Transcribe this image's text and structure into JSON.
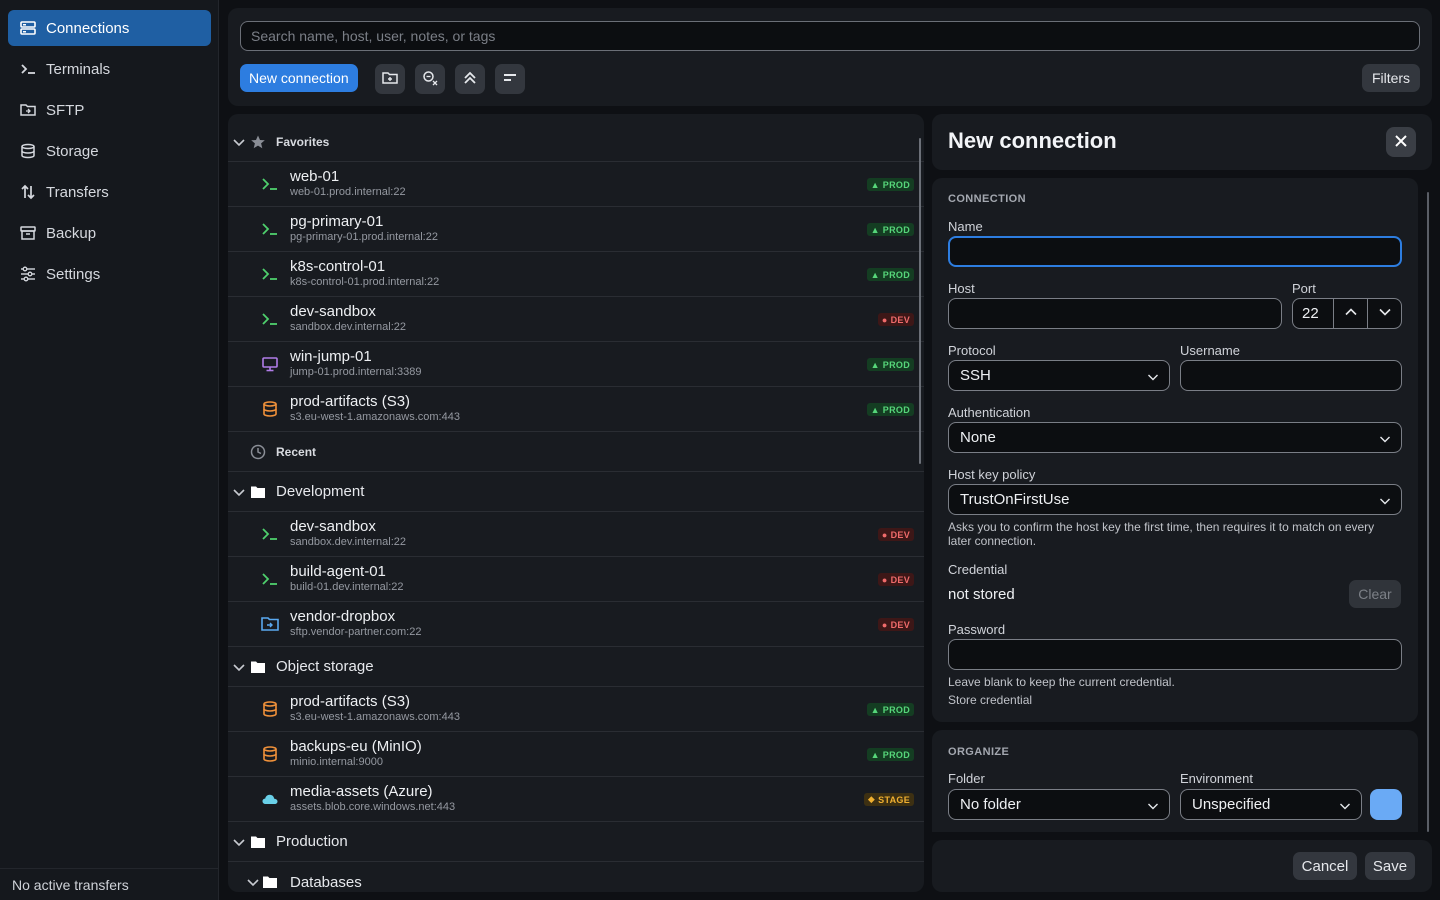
{
  "sidebar": {
    "items": [
      {
        "label": "Connections",
        "icon": "server-stack-icon",
        "active": true
      },
      {
        "label": "Terminals",
        "icon": "terminal-icon"
      },
      {
        "label": "SFTP",
        "icon": "sftp-folder-icon"
      },
      {
        "label": "Storage",
        "icon": "database-icon"
      },
      {
        "label": "Transfers",
        "icon": "transfer-arrows-icon"
      },
      {
        "label": "Backup",
        "icon": "archive-box-icon"
      },
      {
        "label": "Settings",
        "icon": "sliders-icon"
      }
    ],
    "footer": "No active transfers"
  },
  "toolbar": {
    "search_placeholder": "Search name, host, user, notes, or tags",
    "new_connection": "New connection",
    "filters": "Filters"
  },
  "favorites": {
    "title": "Favorites",
    "rows": [
      {
        "name": "web-01",
        "host": "web-01.prod.internal:22",
        "icon": "terminal-icon",
        "env": "PROD"
      },
      {
        "name": "pg-primary-01",
        "host": "pg-primary-01.prod.internal:22",
        "icon": "terminal-icon",
        "env": "PROD"
      },
      {
        "name": "k8s-control-01",
        "host": "k8s-control-01.prod.internal:22",
        "icon": "terminal-icon",
        "env": "PROD"
      },
      {
        "name": "dev-sandbox",
        "host": "sandbox.dev.internal:22",
        "icon": "terminal-icon",
        "env": "DEV"
      },
      {
        "name": "win-jump-01",
        "host": "jump-01.prod.internal:3389",
        "icon": "monitor-icon",
        "env": "PROD"
      },
      {
        "name": "prod-artifacts (S3)",
        "host": "s3.eu-west-1.amazonaws.com:443",
        "icon": "bucket-icon",
        "env": "PROD"
      }
    ]
  },
  "recent": {
    "title": "Recent"
  },
  "development": {
    "title": "Development",
    "rows": [
      {
        "name": "dev-sandbox",
        "host": "sandbox.dev.internal:22",
        "icon": "terminal-icon",
        "env": "DEV"
      },
      {
        "name": "build-agent-01",
        "host": "build-01.dev.internal:22",
        "icon": "terminal-icon",
        "env": "DEV"
      },
      {
        "name": "vendor-dropbox",
        "host": "sftp.vendor-partner.com:22",
        "icon": "sftp-folder-icon",
        "env": "DEV"
      }
    ]
  },
  "object_storage": {
    "title": "Object storage",
    "rows": [
      {
        "name": "prod-artifacts (S3)",
        "host": "s3.eu-west-1.amazonaws.com:443",
        "icon": "bucket-icon",
        "env": "PROD"
      },
      {
        "name": "backups-eu (MinIO)",
        "host": "minio.internal:9000",
        "icon": "bucket-icon",
        "env": "PROD"
      },
      {
        "name": "media-assets (Azure)",
        "host": "assets.blob.core.windows.net:443",
        "icon": "cloud-icon",
        "env": "STAGE"
      }
    ]
  },
  "production": {
    "title": "Production"
  },
  "databases": {
    "title": "Databases"
  },
  "panel": {
    "title": "New connection",
    "connection_section": "CONNECTION",
    "name_label": "Name",
    "name_value": "",
    "host_label": "Host",
    "host_value": "",
    "port_label": "Port",
    "port_value": "22",
    "protocol_label": "Protocol",
    "protocol_value": "SSH",
    "username_label": "Username",
    "username_value": "",
    "auth_label": "Authentication",
    "auth_value": "None",
    "hostkey_label": "Host key policy",
    "hostkey_value": "TrustOnFirstUse",
    "hostkey_help": "Asks you to confirm the host key the first time, then requires it to match on every later connection.",
    "credential_label": "Credential",
    "credential_value": "not stored",
    "clear": "Clear",
    "password_label": "Password",
    "password_help": "Leave blank to keep the current credential.",
    "store_credential": "Store credential",
    "organize_section": "ORGANIZE",
    "folder_label": "Folder",
    "folder_value": "No folder",
    "environment_label": "Environment",
    "environment_value": "Unspecified",
    "cancel": "Cancel",
    "save": "Save"
  },
  "colors": {
    "accent": "#2d7de0",
    "prod": "#56d67a",
    "dev": "#f06b6b",
    "stage": "#f0b030",
    "swatch": "#6aaaf5"
  }
}
